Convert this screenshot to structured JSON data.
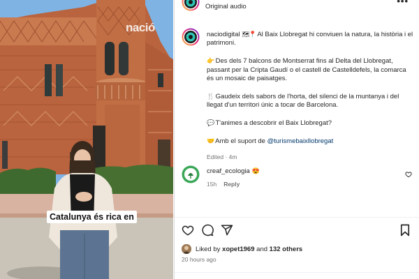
{
  "header": {
    "audio_label": "Original audio",
    "more_label": "•••"
  },
  "media": {
    "watermark": "nació",
    "subtitle": "Catalunya és rica en"
  },
  "post": {
    "username": "naciodigital",
    "caption_line1_rest": "Al Baix Llobregat hi conviuen la natura, la història i el patrimoni.",
    "paragraph2": "Des dels 7 balcons de Montserrat fins al Delta del Llobregat, passant per la Cripta Gaudí o el castell de Castelldefels, la comarca és un mosaic de paisatges.",
    "paragraph3": "Gaudeix dels sabors de l'horta, del silenci de la muntanya i del llegat d'un territori únic a tocar de Barcelona.",
    "paragraph4": "T'animes a descobrir el Baix Llobregat?",
    "support_prefix": "Amb el suport de",
    "support_mention": "@turismebaixllobregat",
    "edited": "Edited",
    "edited_time": "4m"
  },
  "comment": {
    "username": "creaf_ecologia",
    "time": "15h",
    "reply_label": "Reply"
  },
  "likes": {
    "prefix": "Liked by",
    "user": "xopet1969",
    "and": "and",
    "others": "132 others",
    "time_ago": "20 hours ago"
  },
  "icons": {
    "map": "world-map-icon",
    "pin": "pin-icon",
    "pointing": "pointing-hand-icon",
    "cutlery": "fork-knife-icon",
    "speech": "speech-bubble-icon",
    "handshake": "handshake-icon",
    "heart_eyes": "heart-eyes-icon"
  },
  "colors": {
    "mention": "#00376b",
    "secondary_text": "#737373",
    "brick": "#b8603c",
    "sky": "#7eb1e3"
  }
}
